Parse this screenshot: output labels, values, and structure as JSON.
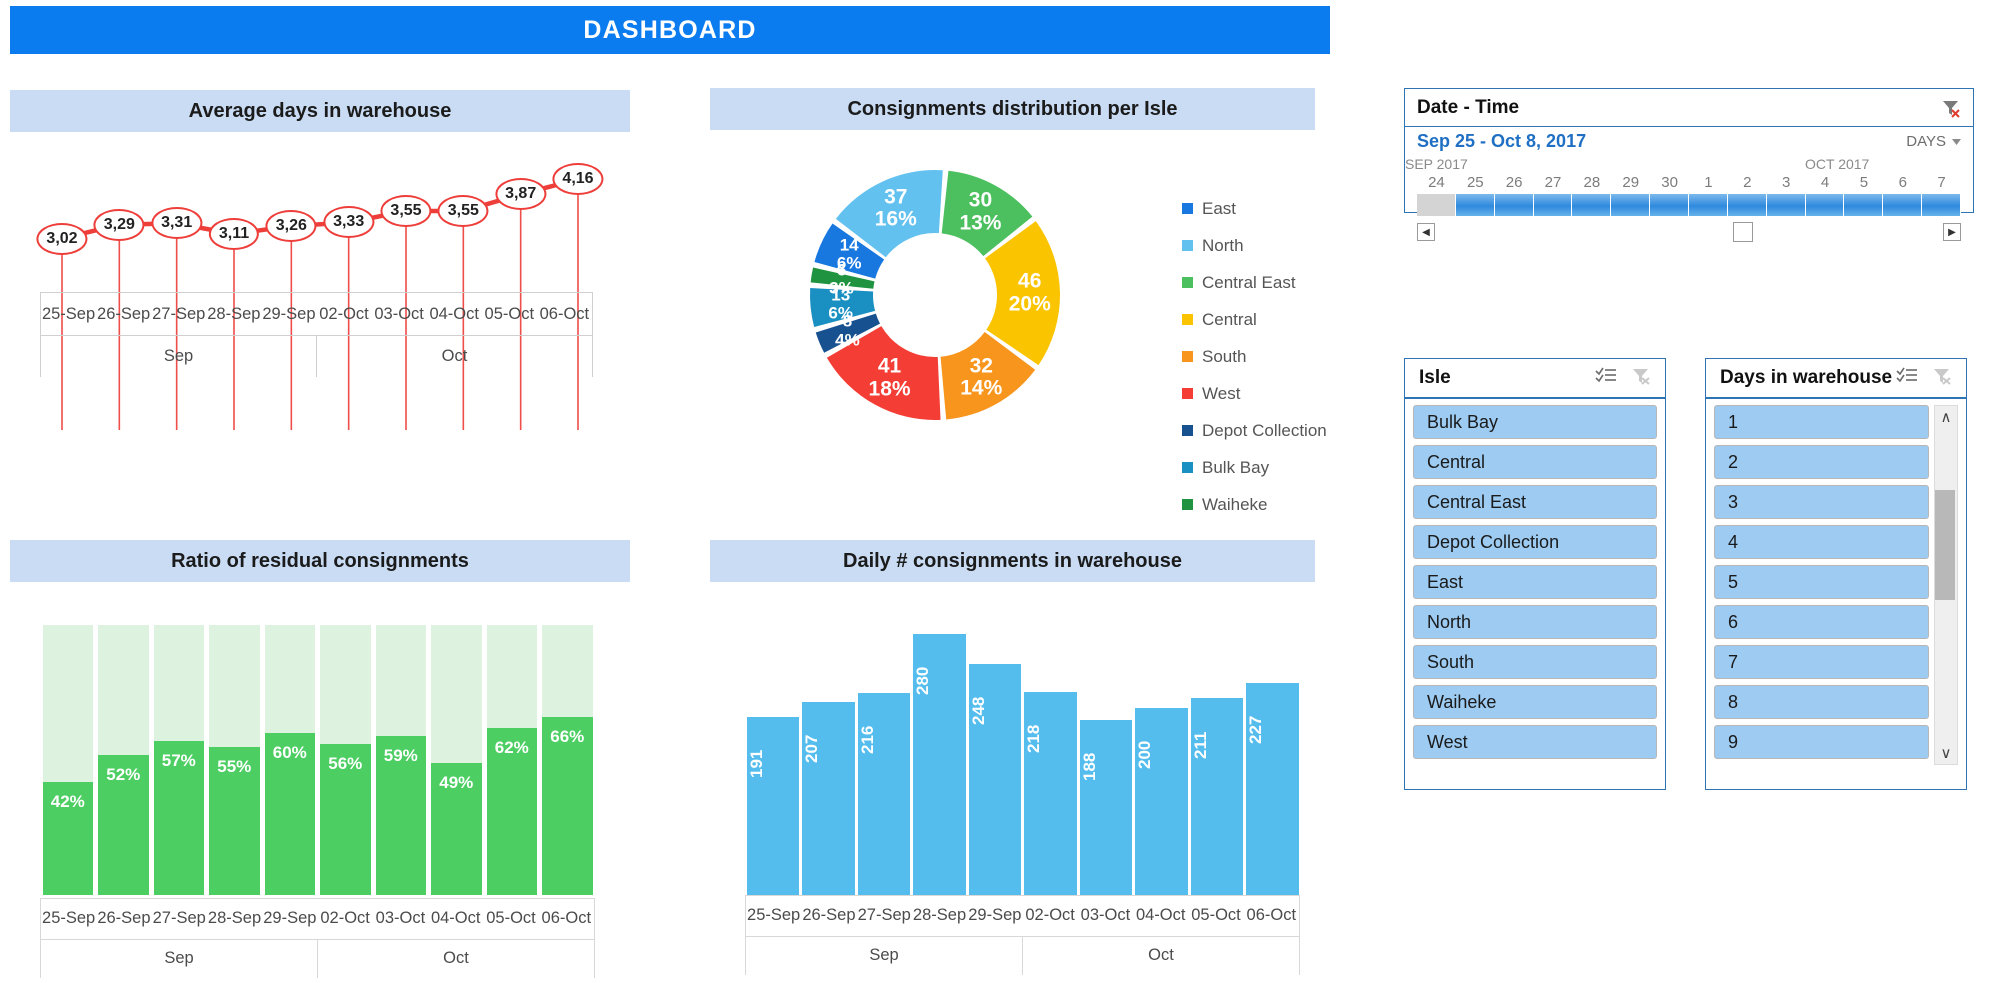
{
  "header": {
    "title": "DASHBOARD",
    "accent": "#0a7cf0"
  },
  "panels": {
    "avg_days_title": "Average days in warehouse",
    "donut_title": "Consignments distribution per Isle",
    "ratio_title": "Ratio of residual consignments",
    "daily_title": "Daily # consignments in warehouse"
  },
  "chart_data": [
    {
      "type": "line",
      "title": "Average days in warehouse",
      "categories": [
        "25-Sep",
        "26-Sep",
        "27-Sep",
        "28-Sep",
        "29-Sep",
        "02-Oct",
        "03-Oct",
        "04-Oct",
        "05-Oct",
        "06-Oct"
      ],
      "labels": [
        "3,02",
        "3,29",
        "3,31",
        "3,11",
        "3,26",
        "3,33",
        "3,55",
        "3,55",
        "3,87",
        "4,16"
      ],
      "values": [
        3.02,
        3.29,
        3.31,
        3.11,
        3.26,
        3.33,
        3.55,
        3.55,
        3.87,
        4.16
      ],
      "groups": [
        {
          "name": "Sep",
          "count": 5
        },
        {
          "name": "Oct",
          "count": 5
        }
      ],
      "xlabel": "",
      "ylabel": "",
      "ylim": [
        2.8,
        4.3
      ],
      "series_color": "#ee3e3a",
      "grid": false,
      "legend": "none"
    },
    {
      "type": "pie",
      "title": "Consignments distribution per Isle",
      "legend_position": "right",
      "slices": [
        {
          "label": "East",
          "value": 14,
          "percent": "6%",
          "color": "#1878e0"
        },
        {
          "label": "North",
          "value": 37,
          "percent": "16%",
          "color": "#63c1ef"
        },
        {
          "label": "Central East",
          "value": 30,
          "percent": "13%",
          "color": "#4cbf5e"
        },
        {
          "label": "Central",
          "value": 46,
          "percent": "20%",
          "color": "#fbc400"
        },
        {
          "label": "South",
          "value": 32,
          "percent": "14%",
          "color": "#f7951d"
        },
        {
          "label": "West",
          "value": 41,
          "percent": "18%",
          "color": "#f43e35"
        },
        {
          "label": "Depot Collection",
          "value": 8,
          "percent": "4%",
          "color": "#17518f"
        },
        {
          "label": "Bulk Bay",
          "value": 13,
          "percent": "6%",
          "color": "#1a8fc1"
        },
        {
          "label": "Waiheke",
          "value": 6,
          "percent": "3%",
          "color": "#1f9340"
        }
      ]
    },
    {
      "type": "bar",
      "title": "Ratio of residual consignments",
      "categories": [
        "25-Sep",
        "26-Sep",
        "27-Sep",
        "28-Sep",
        "29-Sep",
        "02-Oct",
        "03-Oct",
        "04-Oct",
        "05-Oct",
        "06-Oct"
      ],
      "values": [
        42,
        52,
        57,
        55,
        60,
        56,
        59,
        49,
        62,
        66
      ],
      "labels": [
        "42%",
        "52%",
        "57%",
        "55%",
        "60%",
        "56%",
        "59%",
        "49%",
        "62%",
        "66%"
      ],
      "groups": [
        {
          "name": "Sep",
          "count": 5
        },
        {
          "name": "Oct",
          "count": 5
        }
      ],
      "ylim": [
        0,
        100
      ],
      "xlabel": "",
      "ylabel": "",
      "bar_color": "#4cce62",
      "background_color": "#ddf3e0",
      "grid": false
    },
    {
      "type": "bar",
      "title": "Daily # consignments in warehouse",
      "categories": [
        "25-Sep",
        "26-Sep",
        "27-Sep",
        "28-Sep",
        "29-Sep",
        "02-Oct",
        "03-Oct",
        "04-Oct",
        "05-Oct",
        "06-Oct"
      ],
      "values": [
        191,
        207,
        216,
        280,
        248,
        218,
        188,
        200,
        211,
        227
      ],
      "labels": [
        "191",
        "207",
        "216",
        "280",
        "248",
        "218",
        "188",
        "200",
        "211",
        "227"
      ],
      "groups": [
        {
          "name": "Sep",
          "count": 5
        },
        {
          "name": "Oct",
          "count": 5
        }
      ],
      "ylim": [
        0,
        300
      ],
      "xlabel": "",
      "ylabel": "",
      "bar_color": "#55bdee",
      "grid": false
    }
  ],
  "timeline_slicer": {
    "title": "Date - Time",
    "range": "Sep 25 - Oct 8, 2017",
    "level": "DAYS",
    "months": [
      "SEP 2017",
      "OCT 2017"
    ],
    "days": [
      "24",
      "25",
      "26",
      "27",
      "28",
      "29",
      "30",
      "1",
      "2",
      "3",
      "4",
      "5",
      "6",
      "7"
    ],
    "selected_from_index": 1,
    "prev_label": "◀",
    "next_label": "▶"
  },
  "isle_slicer": {
    "title": "Isle",
    "items": [
      "Bulk Bay",
      "Central",
      "Central East",
      "Depot Collection",
      "East",
      "North",
      "South",
      "Waiheke",
      "West"
    ]
  },
  "days_slicer": {
    "title": "Days in warehouse",
    "items": [
      "1",
      "2",
      "3",
      "4",
      "5",
      "6",
      "7",
      "8",
      "9"
    ],
    "scroll_up": "∧",
    "scroll_down": "∨"
  }
}
